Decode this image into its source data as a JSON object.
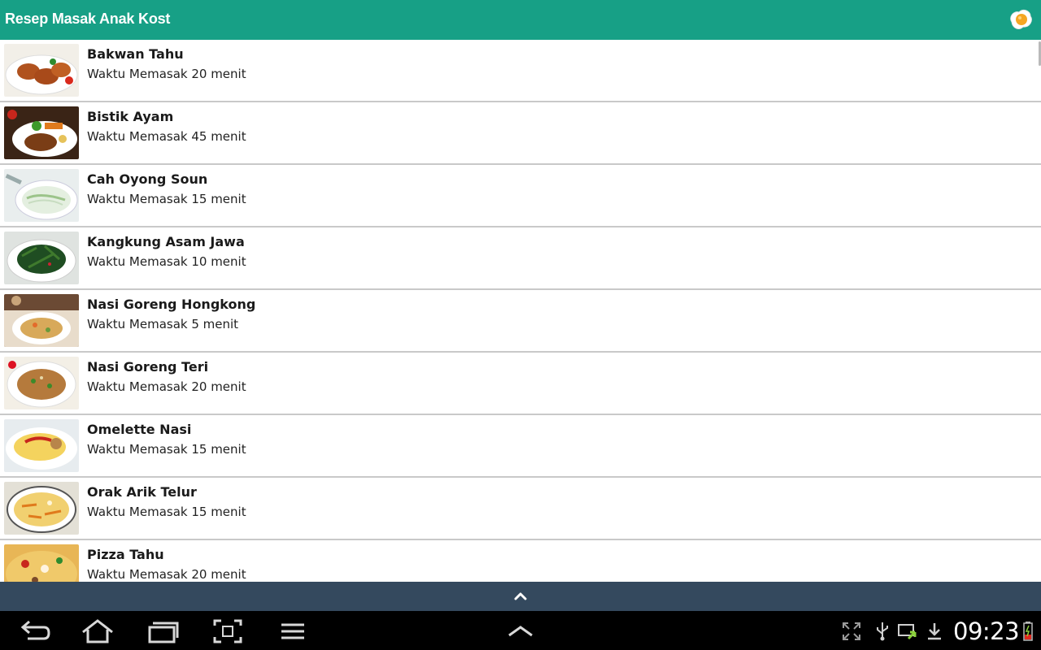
{
  "app": {
    "title": "Resep Masak Anak Kost",
    "icon": "fried-egg-icon"
  },
  "recipes": [
    {
      "name": "Bakwan Tahu",
      "time": "Waktu Memasak 20 menit"
    },
    {
      "name": "Bistik Ayam",
      "time": "Waktu Memasak 45 menit"
    },
    {
      "name": "Cah Oyong Soun",
      "time": "Waktu Memasak 15 menit"
    },
    {
      "name": "Kangkung Asam Jawa",
      "time": "Waktu Memasak 10 menit"
    },
    {
      "name": "Nasi Goreng Hongkong",
      "time": "Waktu Memasak 5 menit"
    },
    {
      "name": "Nasi Goreng Teri",
      "time": "Waktu Memasak 20 menit"
    },
    {
      "name": "Omelette Nasi",
      "time": "Waktu Memasak 15 menit"
    },
    {
      "name": "Orak Arik Telur",
      "time": "Waktu Memasak 15 menit"
    },
    {
      "name": "Pizza Tahu",
      "time": "Waktu Memasak 20 menit"
    }
  ],
  "drawer": {
    "icon": "chevron-up-icon"
  },
  "system_bar": {
    "nav_buttons": [
      "back-icon",
      "home-icon",
      "recent-apps-icon",
      "screenshot-icon",
      "menu-icon"
    ],
    "center_icon": "chevron-up-icon",
    "status_icons": [
      "fullscreen-icon",
      "usb-icon",
      "screen-mirror-icon",
      "download-icon",
      "battery-charging-icon"
    ],
    "clock": "09:23"
  },
  "colors": {
    "appbar": "#17a086",
    "drawer_bar": "#34495e",
    "system_bar": "#000000"
  }
}
